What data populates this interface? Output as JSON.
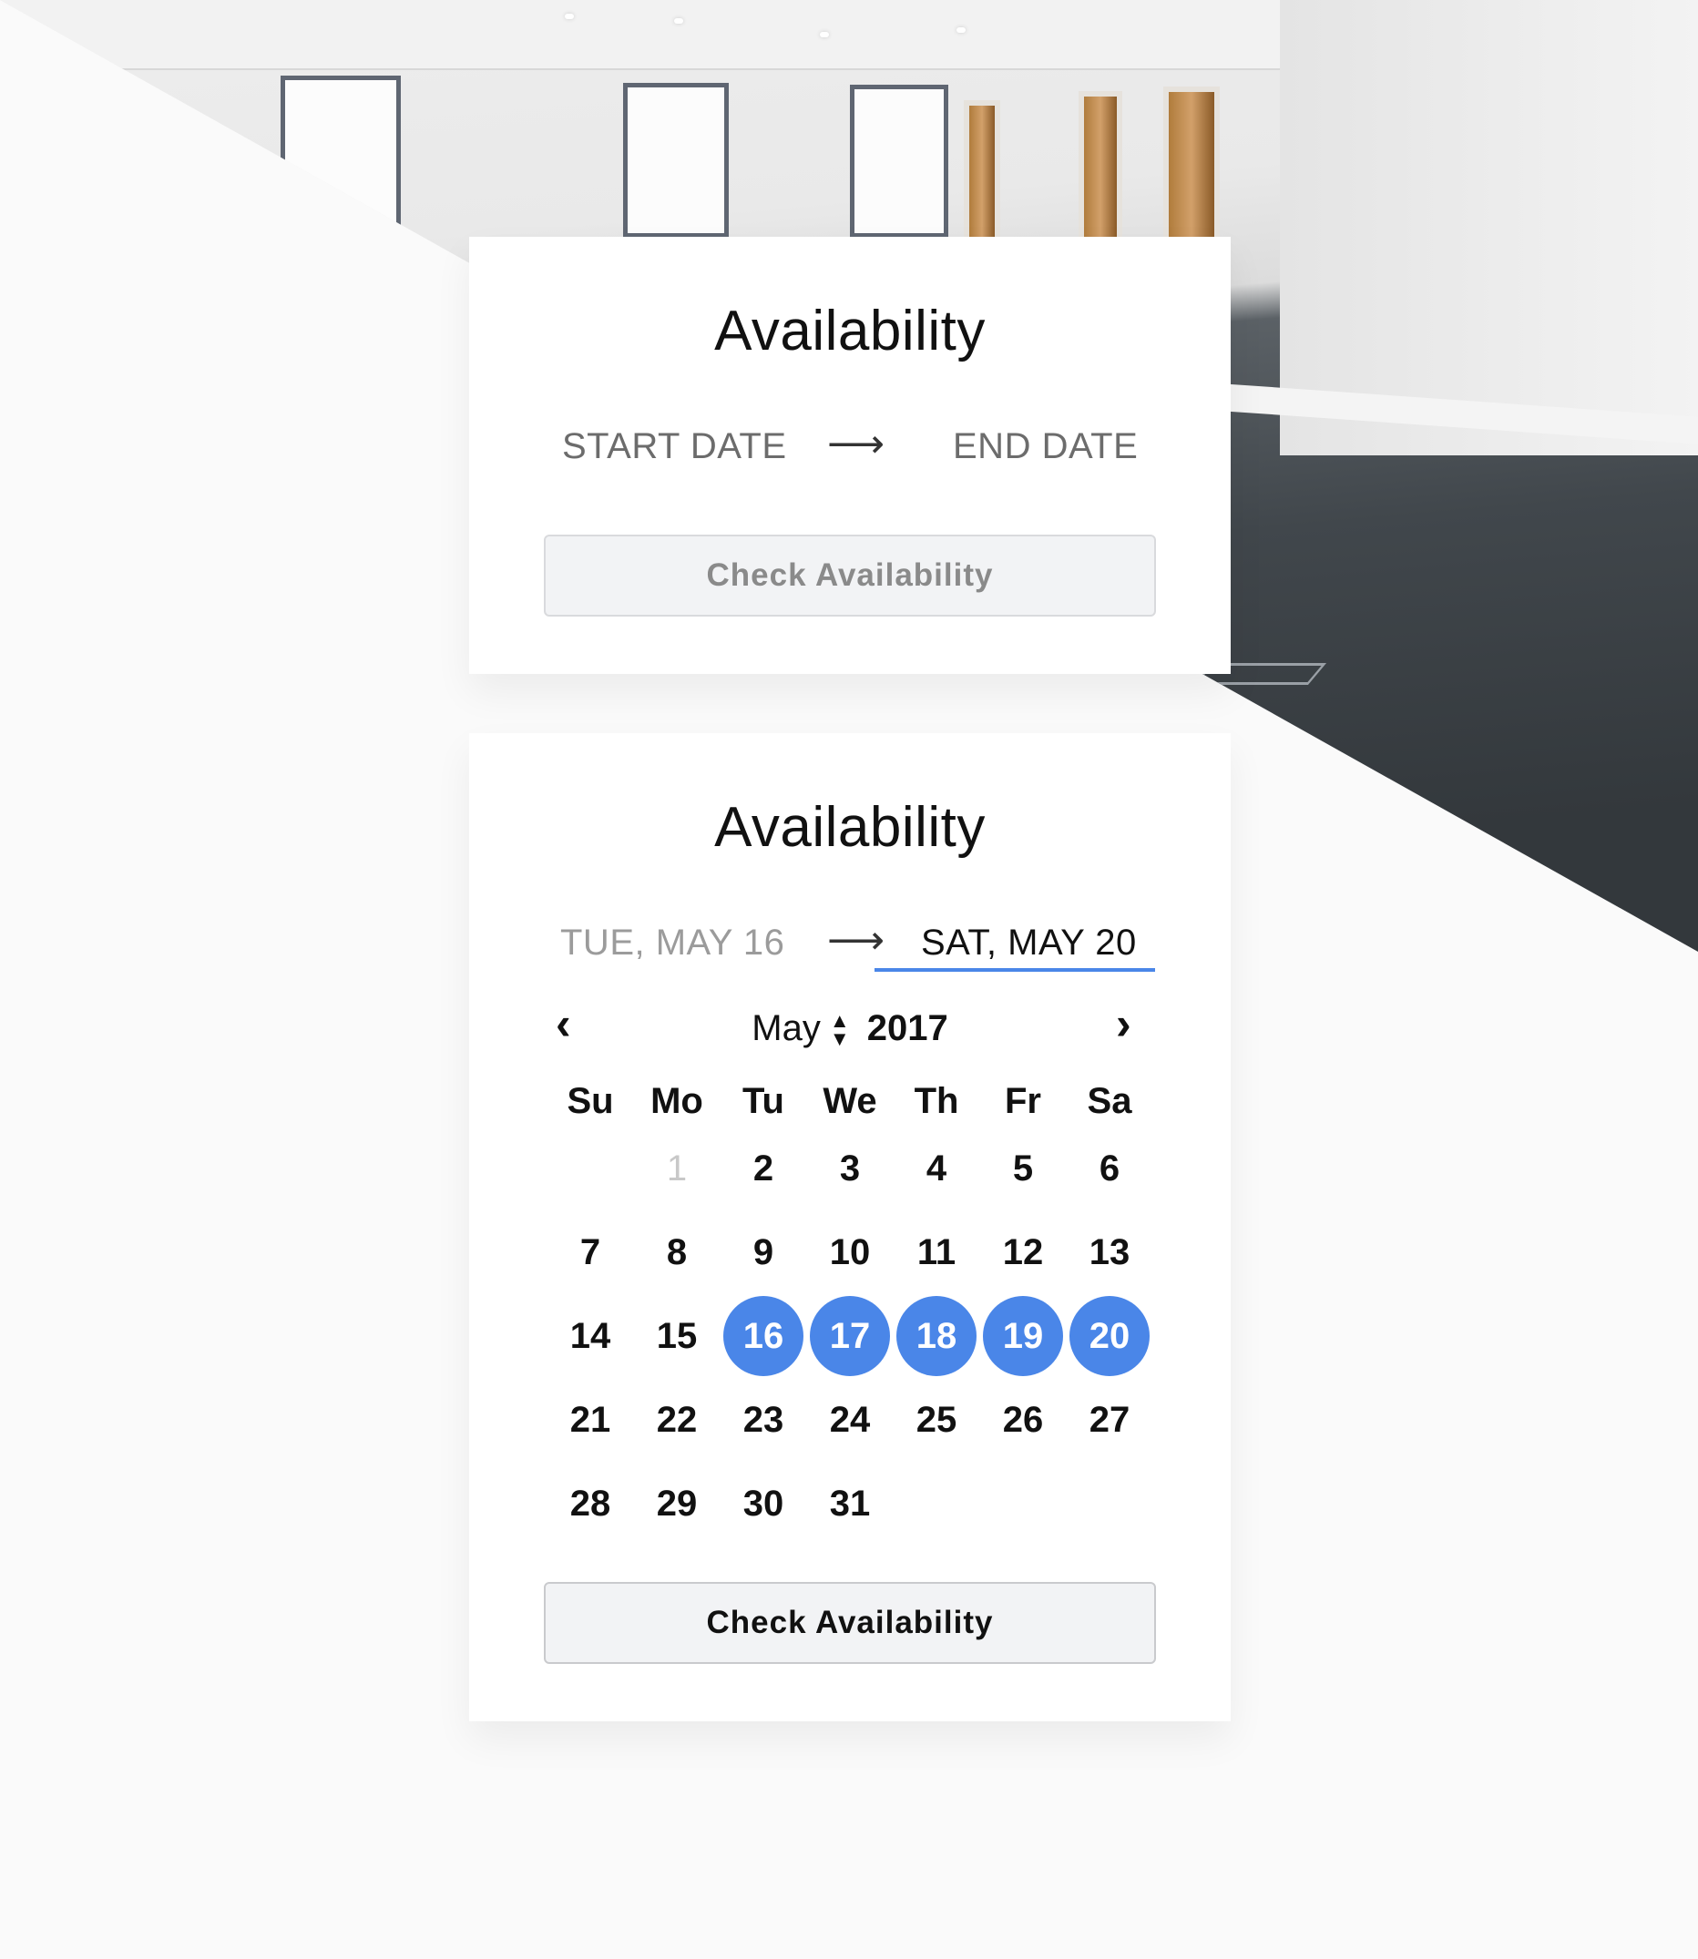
{
  "card1": {
    "title": "Availability",
    "start_label": "START DATE",
    "arrow": "⟶",
    "end_label": "END DATE",
    "button_label": "Check Availability"
  },
  "card2": {
    "title": "Availability",
    "start_value": "TUE, MAY 16",
    "arrow": "⟶",
    "end_value": "SAT, MAY 20",
    "prev_icon": "‹",
    "next_icon": "›",
    "month": "May",
    "year": "2017",
    "weekdays": [
      "Su",
      "Mo",
      "Tu",
      "We",
      "Th",
      "Fr",
      "Sa"
    ],
    "days": [
      [
        "",
        "1",
        "2",
        "3",
        "4",
        "5",
        "6"
      ],
      [
        "7",
        "8",
        "9",
        "10",
        "11",
        "12",
        "13"
      ],
      [
        "14",
        "15",
        "16",
        "17",
        "18",
        "19",
        "20"
      ],
      [
        "21",
        "22",
        "23",
        "24",
        "25",
        "26",
        "27"
      ],
      [
        "28",
        "29",
        "30",
        "31",
        "",
        "",
        ""
      ]
    ],
    "disabled_days": [
      "1"
    ],
    "selected_days": [
      "16",
      "17",
      "18",
      "19",
      "20"
    ],
    "button_label": "Check Availability"
  },
  "colors": {
    "accent": "#4a86e8",
    "disabled": "#c8c8c8"
  }
}
